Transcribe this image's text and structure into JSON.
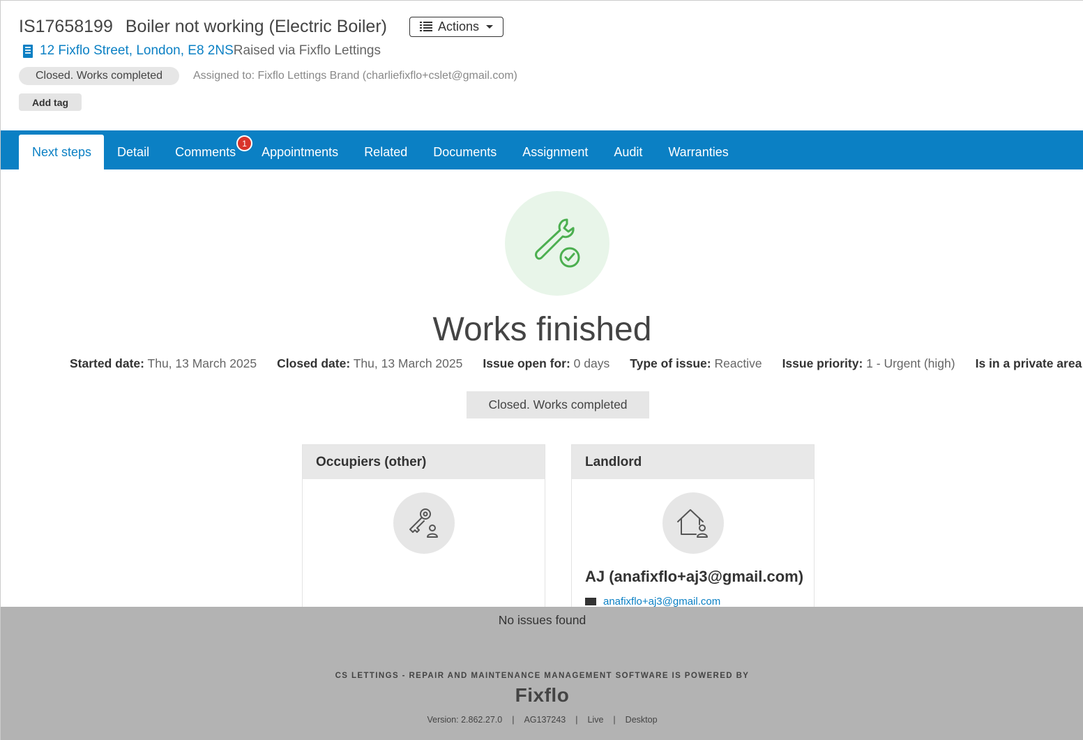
{
  "header": {
    "issue_ref": "IS17658199",
    "issue_title": "Boiler not working (Electric Boiler)",
    "actions_label": "Actions",
    "address": "12 Fixflo Street, London, E8 2NS",
    "raised_via": "Raised via Fixflo Lettings",
    "status": "Closed. Works completed",
    "assigned_to": "Assigned to: Fixflo Lettings Brand (charliefixflo+cslet@gmail.com)",
    "add_tag_label": "Add tag"
  },
  "tabs": [
    {
      "label": "Next steps",
      "active": true
    },
    {
      "label": "Detail"
    },
    {
      "label": "Comments",
      "badge": "1"
    },
    {
      "label": "Appointments"
    },
    {
      "label": "Related"
    },
    {
      "label": "Documents"
    },
    {
      "label": "Assignment"
    },
    {
      "label": "Audit"
    },
    {
      "label": "Warranties"
    }
  ],
  "main": {
    "heading": "Works finished",
    "meta": [
      {
        "label": "Started date:",
        "value": "Thu, 13 March 2025"
      },
      {
        "label": "Closed date:",
        "value": "Thu, 13 March 2025"
      },
      {
        "label": "Issue open for:",
        "value": "0 days"
      },
      {
        "label": "Type of issue:",
        "value": "Reactive"
      },
      {
        "label": "Issue priority:",
        "value": "1 - Urgent (high)"
      },
      {
        "label": "Is in a private area",
        "value": ""
      }
    ],
    "status_box": "Closed. Works completed"
  },
  "cards": {
    "occupiers": {
      "title": "Occupiers (other)"
    },
    "landlord": {
      "title": "Landlord",
      "name": "AJ (anafixflo+aj3@gmail.com)",
      "email": "anafixflo+aj3@gmail.com"
    }
  },
  "footer": {
    "no_issues": "No issues found",
    "powered_by": "CS LETTINGS - REPAIR AND MAINTENANCE MANAGEMENT SOFTWARE IS POWERED BY",
    "brand": "Fixflo",
    "version": "Version: 2.862.27.0",
    "build": "AG137243",
    "env": "Live",
    "mode": "Desktop"
  },
  "colors": {
    "accent": "#0b80c4",
    "badge": "#d9342b",
    "success": "#4caf50",
    "footer_bg": "#b3b3b3"
  }
}
